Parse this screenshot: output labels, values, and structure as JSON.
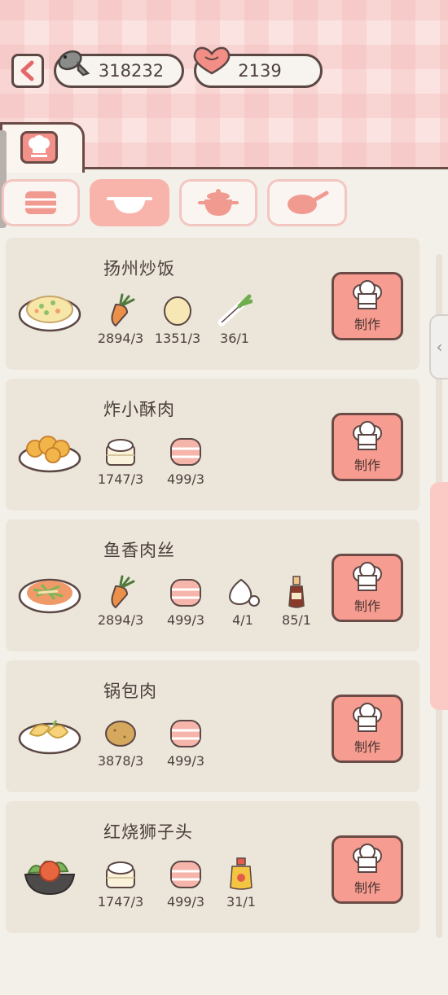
{
  "currency": {
    "fish": "318232",
    "hearts": "2139"
  },
  "make_label": "制作",
  "recipes": [
    {
      "name": "扬州炒饭",
      "ingredients": [
        {
          "icon": "carrot-icon",
          "count": "2894/3"
        },
        {
          "icon": "egg-icon",
          "count": "1351/3"
        },
        {
          "icon": "scallion-icon",
          "count": "36/1"
        }
      ]
    },
    {
      "name": "炸小酥肉",
      "ingredients": [
        {
          "icon": "flour-icon",
          "count": "1747/3"
        },
        {
          "icon": "pork-icon",
          "count": "499/3"
        }
      ]
    },
    {
      "name": "鱼香肉丝",
      "ingredients": [
        {
          "icon": "carrot-icon",
          "count": "2894/3"
        },
        {
          "icon": "pork-icon",
          "count": "499/3"
        },
        {
          "icon": "garlic-icon",
          "count": "4/1"
        },
        {
          "icon": "soy-sauce-icon",
          "count": "85/1"
        }
      ]
    },
    {
      "name": "锅包肉",
      "ingredients": [
        {
          "icon": "potato-icon",
          "count": "3878/3"
        },
        {
          "icon": "pork-icon",
          "count": "499/3"
        }
      ]
    },
    {
      "name": "红烧狮子头",
      "ingredients": [
        {
          "icon": "flour-icon",
          "count": "1747/3"
        },
        {
          "icon": "pork-icon",
          "count": "499/3"
        },
        {
          "icon": "oil-icon",
          "count": "31/1"
        }
      ]
    }
  ],
  "colors": {
    "accent": "#f69c90",
    "outline": "#5b4744",
    "card": "#ece5d9"
  }
}
